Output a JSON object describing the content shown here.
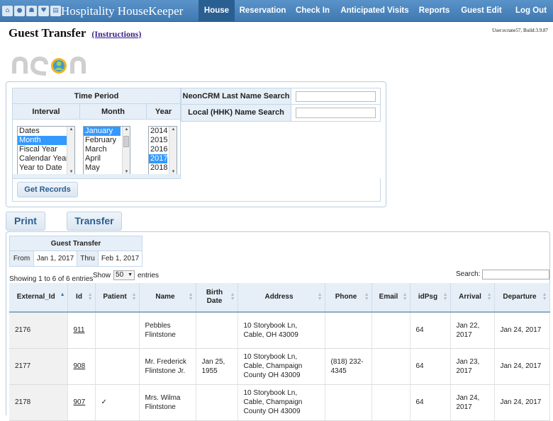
{
  "app": {
    "title": "Hospitality HouseKeeper",
    "nav": [
      "House",
      "Reservation",
      "Check In",
      "Anticipated Visits",
      "Reports",
      "Guest Edit",
      "Log Out"
    ],
    "active_nav": "House"
  },
  "page": {
    "title": "Guest Transfer",
    "instructions": "(Instructions)",
    "user_info": "User:ecrane57, Build:3.9.87"
  },
  "logo_text": "neon",
  "time_period": {
    "title": "Time Period",
    "interval_label": "Interval",
    "month_label": "Month",
    "year_label": "Year",
    "intervals": [
      "Dates",
      "Month",
      "Fiscal Year",
      "Calendar Year",
      "Year to Date"
    ],
    "selected_interval": "Month",
    "months": [
      "January",
      "February",
      "March",
      "April",
      "May"
    ],
    "selected_month": "January",
    "years": [
      "2014",
      "2015",
      "2016",
      "2017",
      "2018"
    ],
    "selected_year": "2017"
  },
  "search": {
    "neon_label": "NeonCRM Last Name Search",
    "local_label": "Local (HHK) Name Search",
    "neon_value": "",
    "local_value": ""
  },
  "buttons": {
    "get_records": "Get Records",
    "print": "Print",
    "transfer": "Transfer"
  },
  "guest_transfer": {
    "title": "Guest Transfer",
    "from_label": "From",
    "from_value": "Jan 1, 2017",
    "thru_label": "Thru",
    "thru_value": "Feb 1, 2017"
  },
  "table_controls": {
    "showing": "Showing 1 to 6 of 6 entries",
    "show_label": "Show",
    "page_size": "50",
    "entries_label": "entries",
    "search_label": "Search:"
  },
  "table": {
    "columns": [
      "External_Id",
      "Id",
      "Patient",
      "Name",
      "Birth Date",
      "Address",
      "Phone",
      "Email",
      "idPsg",
      "Arrival",
      "Departure"
    ],
    "rows": [
      {
        "external_id": "2176",
        "id": "911",
        "patient": "",
        "name": "Pebbles Flintstone",
        "birth_date": "",
        "address": "10 Storybook Ln, Cable, OH 43009",
        "phone": "",
        "email": "",
        "idpsg": "64",
        "arrival": "Jan 22, 2017",
        "departure": "Jan 24, 2017"
      },
      {
        "external_id": "2177",
        "id": "908",
        "patient": "",
        "name": "Mr. Frederick Flintstone Jr.",
        "birth_date": "Jan 25, 1955",
        "address": "10 Storybook Ln, Cable, Champaign County OH 43009",
        "phone": "(818) 232-4345",
        "email": "",
        "idpsg": "64",
        "arrival": "Jan 23, 2017",
        "departure": "Jan 24, 2017"
      },
      {
        "external_id": "2178",
        "id": "907",
        "patient": "✓",
        "name": "Mrs. Wilma Flintstone",
        "birth_date": "",
        "address": "10 Storybook Ln, Cable, Champaign County OH 43009",
        "phone": "",
        "email": "",
        "idpsg": "64",
        "arrival": "Jan 24, 2017",
        "departure": "Jan 24, 2017"
      }
    ]
  },
  "colors": {
    "nav_bg": "#4a86be",
    "nav_active": "#2a5f92",
    "panel_header": "#e6eff7",
    "button_text": "#2b5d8e",
    "selection": "#3399ff"
  }
}
